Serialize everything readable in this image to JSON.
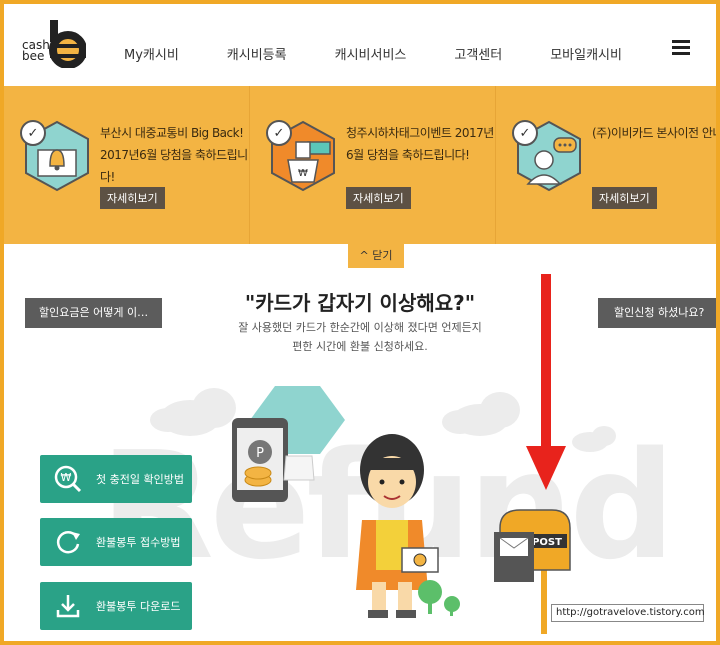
{
  "logo": {
    "line1": "cash",
    "line2": "bee"
  },
  "nav": {
    "items": [
      "My캐시비",
      "캐시비등록",
      "캐시비서비스",
      "고객센터",
      "모바일캐시비"
    ]
  },
  "notices": [
    {
      "text": "부산시 대중교통비 Big Back! 2017년6월 당첨을 축하드립니다!",
      "button": "자세히보기",
      "icon": "bell-icon"
    },
    {
      "text": "청주시하차태그이벤트 2017년6월 당첨을 축하드립니다!",
      "button": "자세히보기",
      "icon": "bus-card-icon"
    },
    {
      "text": "(주)이비카드 본사이전 안내",
      "button": "자세히보기",
      "icon": "person-chat-icon"
    }
  ],
  "close_label": "^ 닫기",
  "refund": {
    "headline": "\"카드가 갑자기 이상해요?\"",
    "sub_line1": "잘 사용했던 카드가 한순간에 이상해 졌다면 언제든지",
    "sub_line2": "편한 시간에 환불 신청하세요.",
    "left_tab": "할인요금은 어떻게 이…",
    "right_tab": "할인신청 하셨나요?",
    "background_word": "Refund",
    "buttons": [
      {
        "label": "첫 충전일 확인방법",
        "icon": "won-search-icon"
      },
      {
        "label": "환불봉투 접수방법",
        "icon": "refresh-icon"
      },
      {
        "label": "환불봉투 다운로드",
        "icon": "download-icon"
      }
    ],
    "mailbox_label": "POST",
    "coin_label": "P",
    "card_label": "cash bee"
  },
  "watermark": "http://gotravelove.tistory.com",
  "colors": {
    "accent": "#f3b443",
    "frame": "#f0a826",
    "green": "#2aa287",
    "arrow": "#e8231c",
    "dark_tab": "#5c5c5c"
  }
}
